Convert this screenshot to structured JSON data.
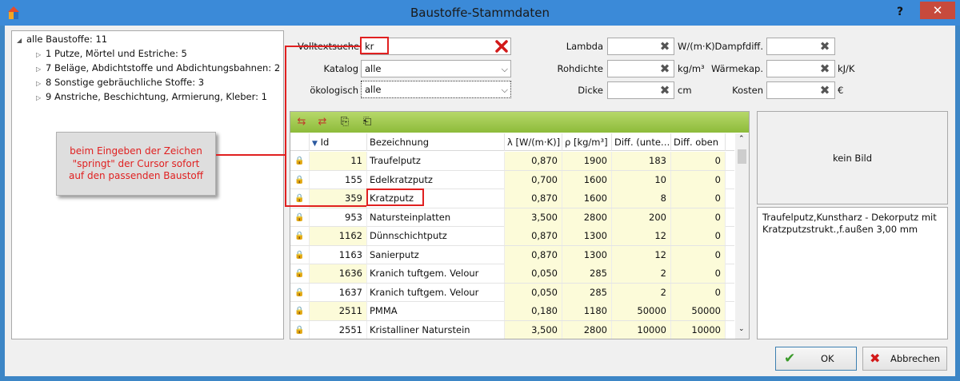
{
  "window": {
    "title": "Baustoffe-Stammdaten",
    "help": "?",
    "close": "✕"
  },
  "tree": {
    "root": "alle Baustoffe: 11",
    "items": [
      "1 Putze, Mörtel und Estriche: 5",
      "7 Beläge, Abdichtstoffe und Abdichtungsbahnen: 2",
      "8 Sonstige gebräuchliche Stoffe: 3",
      "9 Anstriche, Beschichtung, Armierung, Kleber: 1"
    ]
  },
  "filters": {
    "fulltext_label": "Volltextsuche",
    "fulltext_value": "kr",
    "catalog_label": "Katalog",
    "catalog_value": "alle",
    "ecological_label": "ökologisch",
    "ecological_value": "alle",
    "lambda_label": "Lambda",
    "lambda_unit": "W/(m·K)",
    "density_label": "Rohdichte",
    "density_unit": "kg/m³",
    "thickness_label": "Dicke",
    "thickness_unit": "cm",
    "vapor_label": "Dampfdiff.",
    "heat_label": "Wärmekap.",
    "heat_unit": "kJ/K",
    "cost_label": "Kosten",
    "cost_unit": "€"
  },
  "grid": {
    "headers": {
      "id": "Id",
      "name": "Bezeichnung",
      "lambda": "λ [W/(m·K)]",
      "rho": "ρ [kg/m³]",
      "diff_lower": "Diff. (unte…",
      "diff_upper": "Diff. oben"
    },
    "rows": [
      {
        "id": "11",
        "name": "Traufelputz",
        "lambda": "0,870",
        "rho": "1900",
        "diff_lower": "183",
        "diff_upper": "0"
      },
      {
        "id": "155",
        "name": "Edelkratzputz",
        "lambda": "0,700",
        "rho": "1600",
        "diff_lower": "10",
        "diff_upper": "0"
      },
      {
        "id": "359",
        "name": "Kratzputz",
        "lambda": "0,870",
        "rho": "1600",
        "diff_lower": "8",
        "diff_upper": "0"
      },
      {
        "id": "953",
        "name": "Natursteinplatten",
        "lambda": "3,500",
        "rho": "2800",
        "diff_lower": "200",
        "diff_upper": "0"
      },
      {
        "id": "1162",
        "name": "Dünnschichtputz",
        "lambda": "0,870",
        "rho": "1300",
        "diff_lower": "12",
        "diff_upper": "0"
      },
      {
        "id": "1163",
        "name": "Sanierputz",
        "lambda": "0,870",
        "rho": "1300",
        "diff_lower": "12",
        "diff_upper": "0"
      },
      {
        "id": "1636",
        "name": "Kranich tuftgem. Velour",
        "lambda": "0,050",
        "rho": "285",
        "diff_lower": "2",
        "diff_upper": "0"
      },
      {
        "id": "1637",
        "name": "Kranich tuftgem. Velour",
        "lambda": "0,050",
        "rho": "285",
        "diff_lower": "2",
        "diff_upper": "0"
      },
      {
        "id": "2511",
        "name": "PMMA",
        "lambda": "0,180",
        "rho": "1180",
        "diff_lower": "50000",
        "diff_upper": "50000"
      },
      {
        "id": "2551",
        "name": "Kristalliner Naturstein",
        "lambda": "3,500",
        "rho": "2800",
        "diff_lower": "10000",
        "diff_upper": "10000"
      }
    ]
  },
  "image_placeholder": "kein Bild",
  "description": "Traufelputz,Kunstharz - Dekorputz mit Kratzputzstrukt.,f.außen 3,00 mm",
  "callout": {
    "line1": "beim Eingeben der Zeichen",
    "line2": "\"springt\" der Cursor sofort",
    "line3": "auf den passenden Baustoff"
  },
  "buttons": {
    "ok": "OK",
    "cancel": "Abbrechen"
  },
  "colors": {
    "titlebar": "#3b8ad8",
    "highlight_row": "#fcfbd9",
    "annotation": "#e02020",
    "toolbar": "#9ec84a"
  }
}
